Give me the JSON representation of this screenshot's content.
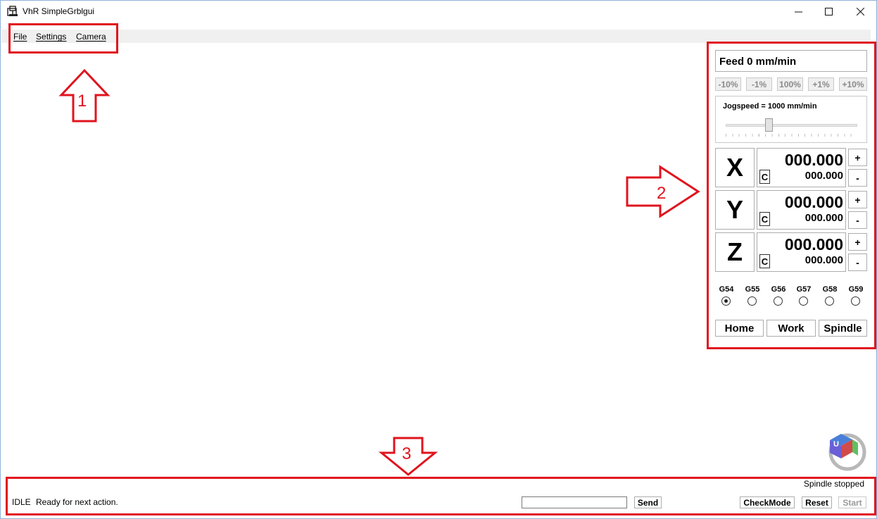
{
  "window": {
    "title": "VhR SimpleGrblgui",
    "controls": {
      "minimize": "—",
      "maximize": "☐",
      "close": "✕"
    }
  },
  "menu": [
    "File",
    "Settings",
    "Camera"
  ],
  "annotations": {
    "n1": "1",
    "n2": "2",
    "n3": "3",
    "color": "#e0141e"
  },
  "panel": {
    "feed": "Feed 0 mm/min",
    "overrides": [
      "-10%",
      "-1%",
      "100%",
      "+1%",
      "+10%"
    ],
    "jogspeed_label": "Jogspeed = 1000 mm/min",
    "jogspeed_fraction": 0.32,
    "axes": [
      {
        "letter": "X",
        "main": "000.000",
        "sub": "000.000",
        "c": "C",
        "plus": "+",
        "minus": "-"
      },
      {
        "letter": "Y",
        "main": "000.000",
        "sub": "000.000",
        "c": "C",
        "plus": "+",
        "minus": "-"
      },
      {
        "letter": "Z",
        "main": "000.000",
        "sub": "000.000",
        "c": "C",
        "plus": "+",
        "minus": "-"
      }
    ],
    "coord_systems": [
      "G54",
      "G55",
      "G56",
      "G57",
      "G58",
      "G59"
    ],
    "selected_coord": "G54",
    "buttons": {
      "home": "Home",
      "work": "Work",
      "spindle": "Spindle"
    }
  },
  "status": {
    "spindle": "Spindle stopped",
    "state": "IDLE",
    "message": "Ready for next action.",
    "command_value": "",
    "send": "Send",
    "checkmode": "CheckMode",
    "reset": "Reset",
    "start": "Start"
  },
  "logo_letter": "U"
}
